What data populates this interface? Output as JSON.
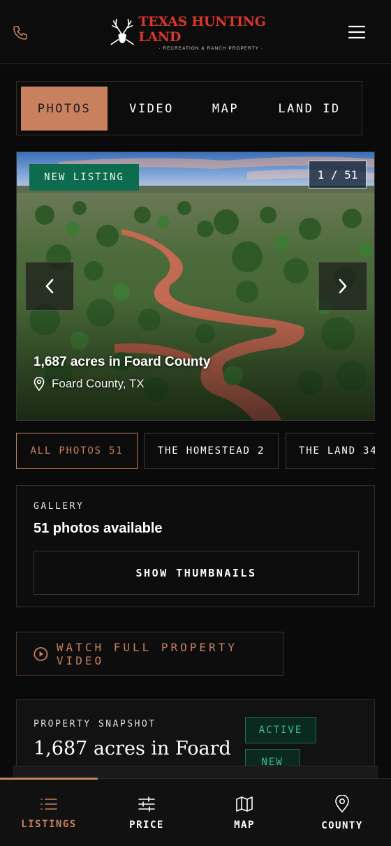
{
  "header": {
    "logo_title": "TEXAS HUNTING LAND",
    "logo_subtitle": "· RECREATION & RANCH PROPERTY ·",
    "phone_icon": "phone-icon",
    "menu_icon": "hamburger-menu-icon"
  },
  "media_tabs": [
    {
      "label": "PHOTOS",
      "active": true
    },
    {
      "label": "VIDEO",
      "active": false
    },
    {
      "label": "MAP",
      "active": false
    },
    {
      "label": "LAND ID",
      "active": false
    }
  ],
  "hero": {
    "badge": "NEW LISTING",
    "counter": "1 / 51",
    "title": "1,687 acres in Foard County",
    "location": "Foard County, TX"
  },
  "chips": [
    {
      "label": "ALL PHOTOS 51",
      "active": true
    },
    {
      "label": "THE HOMESTEAD 2",
      "active": false
    },
    {
      "label": "THE LAND 34",
      "active": false
    }
  ],
  "gallery": {
    "label": "GALLERY",
    "count_text": "51 photos available",
    "button": "SHOW THUMBNAILS"
  },
  "video": {
    "button": "WATCH FULL PROPERTY VIDEO"
  },
  "snapshot": {
    "label": "PROPERTY SNAPSHOT",
    "title": "1,687 acres in Foard",
    "badges": [
      "ACTIVE",
      "NEW"
    ]
  },
  "bottom_nav": [
    {
      "label": "LISTINGS",
      "icon": "list-icon",
      "active": true
    },
    {
      "label": "PRICE",
      "icon": "sliders-icon",
      "active": false
    },
    {
      "label": "MAP",
      "icon": "map-icon",
      "active": false
    },
    {
      "label": "COUNTY",
      "icon": "location-pin-icon",
      "active": false
    }
  ],
  "colors": {
    "accent": "#c8805f",
    "brand_red": "#d9372a",
    "listing_green": "#0d6b4e",
    "background": "#0a0a0a"
  }
}
